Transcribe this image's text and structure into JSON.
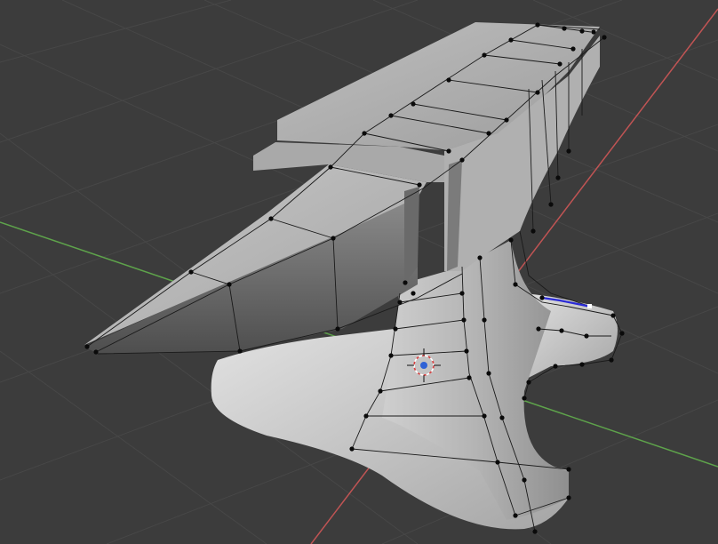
{
  "app": {
    "name": "3D viewport"
  },
  "viewport": {
    "mode": "edit-mode",
    "background": "#3c3c3c",
    "grid_color": "#4a4a4a",
    "x_axis_color": "#c05454",
    "y_axis_color": "#5ea34b",
    "selected_edge_color": "#2b2bd6",
    "vertex_color": "#0a0a0a",
    "cursor_icon": "3d-cursor-icon",
    "mesh_object": "anvil-mesh"
  }
}
